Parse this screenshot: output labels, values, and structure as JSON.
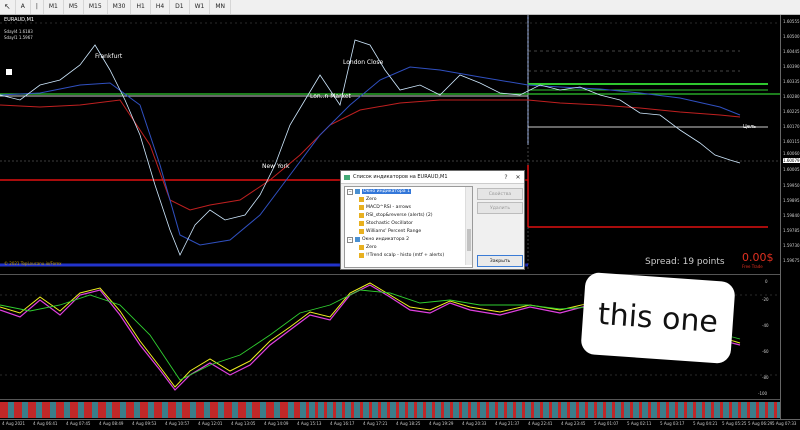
{
  "toolbar": {
    "buttons": [
      "A",
      "|",
      "M1",
      "M5",
      "M15",
      "M30",
      "H1",
      "H4",
      "D1",
      "W1",
      "MN"
    ]
  },
  "chart": {
    "symbol": "EURAUD,M1",
    "info_line1": "Sdayl4 1.6183",
    "info_line2": "Sdayl1 1.5967",
    "copyright": "© 2021 TopLoucanu.io/Forex",
    "annotations": {
      "frankfurt": "Frankfurt",
      "london_close": "London Close",
      "london_market": "Lon..n Market",
      "new_york": "New York",
      "tsel": "Цель"
    },
    "spread": "Spread: 19 points",
    "pnl": "0.00$",
    "pnl_sub": "Free Trade",
    "price_axis": [
      "1.60555",
      "1.60500",
      "1.60445",
      "1.60390",
      "1.60335",
      "1.60280",
      "1.60225",
      "1.60170",
      "1.60115",
      "1.60060",
      "1.60005",
      "1.59950",
      "1.59895",
      "1.59840",
      "1.59785",
      "1.59730",
      "1.59675"
    ],
    "price_current": "1.60079"
  },
  "oscillator": {
    "levels": [
      "0",
      "-20",
      "-40",
      "-60",
      "-80",
      "-100"
    ]
  },
  "time_axis": [
    "4 Aug 2021",
    "4 Aug 06:41",
    "4 Aug 07:45",
    "4 Aug 08:49",
    "4 Aug 09:53",
    "4 Aug 10:57",
    "4 Aug 12:01",
    "4 Aug 13:05",
    "4 Aug 14:09",
    "4 Aug 15:13",
    "4 Aug 16:17",
    "4 Aug 17:21",
    "4 Aug 18:25",
    "4 Aug 19:29",
    "4 Aug 20:33",
    "4 Aug 21:37",
    "4 Aug 22:41",
    "4 Aug 23:45",
    "5 Aug 01:07",
    "5 Aug 02:11",
    "5 Aug 03:17",
    "5 Aug 04:21",
    "5 Aug 05:25",
    "5 Aug 06:29",
    "5 Aug 07:33"
  ],
  "dialog": {
    "title": "Список индикаторов на EURAUD,M1",
    "help": "?",
    "close": "✕",
    "tree": [
      {
        "label": "Окно индикатора 1",
        "level": 0,
        "type": "folder",
        "selected": true,
        "toggle": "−"
      },
      {
        "label": "Zero",
        "level": 1,
        "type": "ind"
      },
      {
        "label": "MACD^RSI - arrows",
        "level": 1,
        "type": "ind"
      },
      {
        "label": "RSI_stop&reverse (alerts) (2)",
        "level": 1,
        "type": "ind"
      },
      {
        "label": "Stochastic Oscillator",
        "level": 1,
        "type": "ind"
      },
      {
        "label": "Williams' Percent Range",
        "level": 1,
        "type": "ind"
      },
      {
        "label": "Окно индикатора 2",
        "level": 0,
        "type": "folder",
        "selected": false,
        "toggle": "−"
      },
      {
        "label": "Zero",
        "level": 1,
        "type": "ind"
      },
      {
        "label": "!!Trend scalp - histo (mtf + alerts)",
        "level": 1,
        "type": "ind"
      }
    ],
    "buttons": {
      "properties": "Свойства",
      "delete": "Удалить",
      "close": "Закрыть"
    }
  },
  "sticker": {
    "text": "this one"
  }
}
